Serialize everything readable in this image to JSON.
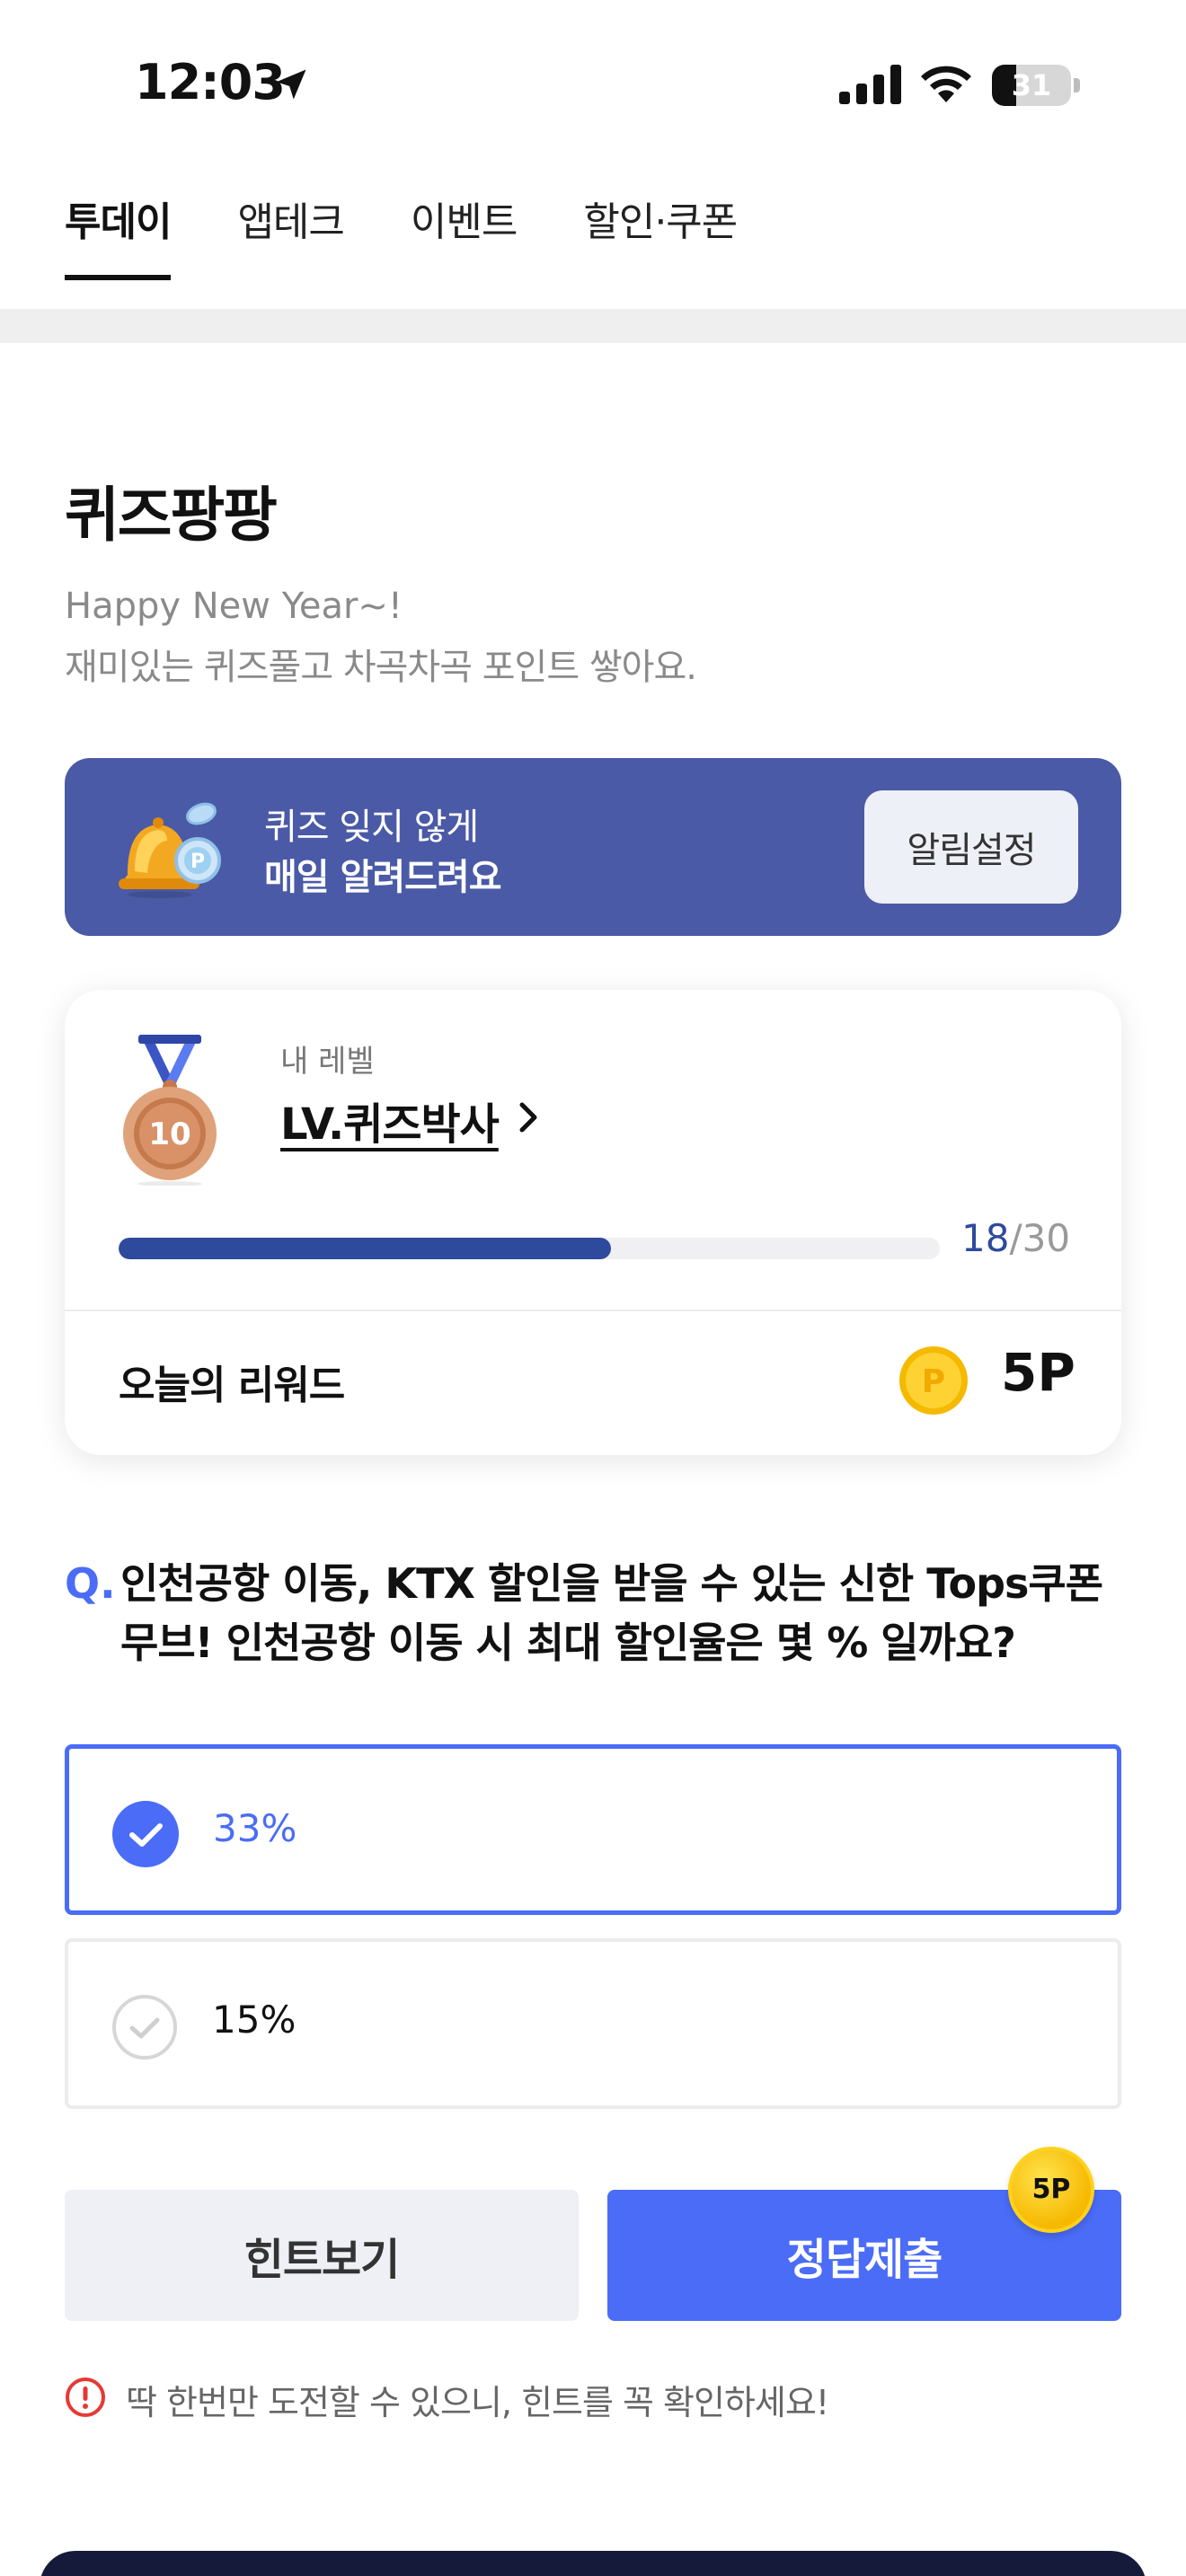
{
  "status_bar": {
    "time": "12:03",
    "battery": "31",
    "battery_level": 0.31
  },
  "tabs": [
    {
      "label": "투데이",
      "active": true
    },
    {
      "label": "앱테크",
      "active": false
    },
    {
      "label": "이벤트",
      "active": false
    },
    {
      "label": "할인·쿠폰",
      "active": false
    }
  ],
  "page": {
    "title": "퀴즈팡팡",
    "subtitle_1": "Happy New Year~!",
    "subtitle_2": "재미있는 퀴즈풀고 차곡차곡 포인트 쌓아요."
  },
  "banner": {
    "line1": "퀴즈 잊지 않게",
    "line2": "매일 알려드려요",
    "button_label": "알림설정",
    "icon": "bell-coin-icon"
  },
  "level_card": {
    "medal_number": "10",
    "label": "내 레벨",
    "level_name": "LV.퀴즈박사",
    "progress_current": "18",
    "progress_total": "/30",
    "progress_fraction": 0.6,
    "reward_label": "오늘의 리워드",
    "reward_value": "5P",
    "coin_glyph": "P"
  },
  "question": {
    "marker": "Q.",
    "text": "인천공항 이동, KTX 할인을 받을 수 있는 신한 Tops쿠폰무브! 인천공항 이동 시 최대 할인율은 몇 % 일까요?"
  },
  "options": [
    {
      "label": "33%",
      "selected": true
    },
    {
      "label": "15%",
      "selected": false
    }
  ],
  "actions": {
    "hint_label": "힌트보기",
    "submit_label": "정답제출",
    "submit_badge": "5P"
  },
  "warning": {
    "text": "딱 한번만 도전할 수 있으니, 힌트를 꼭 확인하세요!"
  },
  "colors": {
    "accent": "#4a6cf7",
    "banner": "#4a5aa6",
    "progress": "#2e4a9c",
    "warning": "#e53935"
  }
}
